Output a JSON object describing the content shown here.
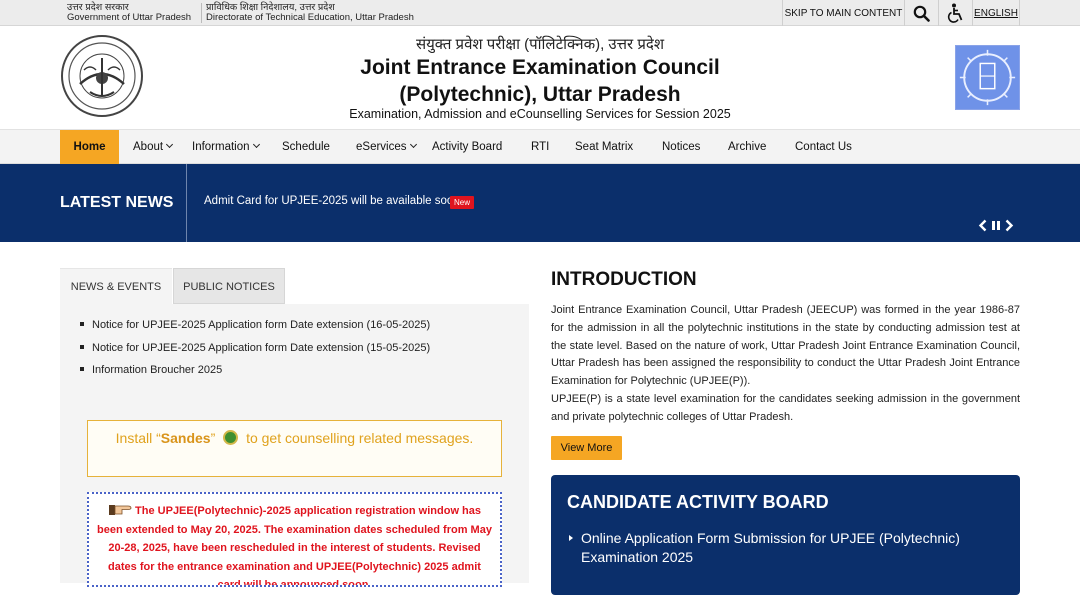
{
  "topbar": {
    "gov_hindi": "उत्तर प्रदेश सरकार",
    "gov_english": "Government of Uttar Pradesh",
    "dept_hindi": "प्राविधिक शिक्षा निदेशालय, उत्तर प्रदेश",
    "dept_english": "Directorate of Technical Education, Uttar Pradesh",
    "skip_label": "SKIP TO MAIN CONTENT",
    "search_icon": "search-icon",
    "accessibility_icon": "accessibility-icon",
    "language_label": "ENGLISH"
  },
  "header": {
    "hindi_title": "संयुक्त प्रवेश परीक्षा (पॉलिटेक्निक), उत्तर प्रदेश",
    "title_line1": "Joint Entrance Examination Council",
    "title_line2": "(Polytechnic), Uttar Pradesh",
    "subtitle": "Examination, Admission and eCounselling Services for Session 2025"
  },
  "nav": {
    "items": [
      {
        "label": "Home",
        "active": true
      },
      {
        "label": "About",
        "dropdown": true
      },
      {
        "label": "Information",
        "dropdown": true
      },
      {
        "label": "Schedule"
      },
      {
        "label": "eServices",
        "dropdown": true
      },
      {
        "label": "Activity Board"
      },
      {
        "label": "RTI"
      },
      {
        "label": "Seat Matrix"
      },
      {
        "label": "Notices"
      },
      {
        "label": "Archive"
      },
      {
        "label": "Contact Us"
      }
    ]
  },
  "latest_news": {
    "label": "LATEST NEWS",
    "text": "Admit Card for UPJEE-2025 will be available soon.",
    "badge": "New"
  },
  "tabs": {
    "active": "NEWS & EVENTS",
    "inactive": "PUBLIC NOTICES"
  },
  "notices": [
    "Notice for UPJEE-2025 Application form Date extension (16-05-2025)",
    "Notice for UPJEE-2025 Application form Date extension (15-05-2025)",
    "Information Broucher 2025"
  ],
  "sandes": {
    "prefix": "Install “",
    "app": "Sandes",
    "suffix_quote": "”",
    "rest": "to get counselling related messages."
  },
  "alert_text": "The UPJEE(Polytechnic)-2025 application registration window has been extended to May 20, 2025. The examination dates scheduled from May 20-28, 2025, have been rescheduled in the interest of students. Revised dates for the entrance examination and UPJEE(Polytechnic) 2025 admit card will be announced soon.",
  "intro": {
    "heading": "INTRODUCTION",
    "para1": "Joint Entrance Examination Council, Uttar Pradesh (JEECUP) was formed in the year 1986-87 for the admission in all the polytechnic institutions in the state by conducting admission test at the state level. Based on the nature of work, Uttar Pradesh Joint Entrance Examination Council, Uttar Pradesh has been assigned the responsibility to conduct the Uttar Pradesh Joint Entrance Examination for Polytechnic (UPJEE(P)).",
    "para2": "UPJEE(P) is a state level examination for the candidates seeking admission in the government and private polytechnic colleges of Uttar Pradesh.",
    "view_more": "View More"
  },
  "activity_board": {
    "heading": "CANDIDATE ACTIVITY BOARD",
    "item1": "Online Application Form Submission for UPJEE (Polytechnic) Examination 2025"
  },
  "colors": {
    "navy": "#0b2f6b",
    "accent": "#f5a623",
    "alert_red": "#e0141e"
  }
}
